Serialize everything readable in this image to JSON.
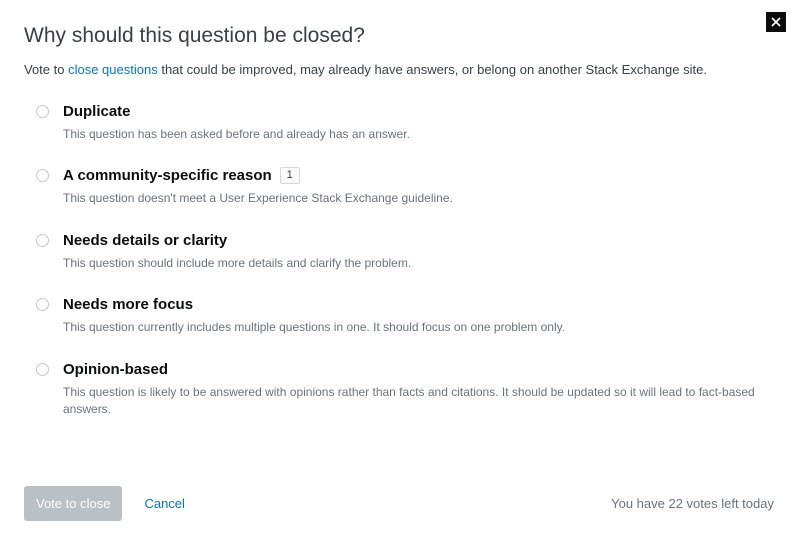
{
  "dialog": {
    "title": "Why should this question be closed?",
    "subtitle_pre": "Vote to ",
    "subtitle_link": "close questions",
    "subtitle_post": " that could be improved, may already have answers, or belong on another Stack Exchange site."
  },
  "options": [
    {
      "title": "Duplicate",
      "desc": "This question has been asked before and already has an answer."
    },
    {
      "title": "A community-specific reason",
      "badge": "1",
      "desc": "This question doesn't meet a User Experience Stack Exchange guideline."
    },
    {
      "title": "Needs details or clarity",
      "desc": "This question should include more details and clarify the problem."
    },
    {
      "title": "Needs more focus",
      "desc": "This question currently includes multiple questions in one. It should focus on one problem only."
    },
    {
      "title": "Opinion-based",
      "desc": "This question is likely to be answered with opinions rather than facts and citations. It should be updated so it will lead to fact-based answers."
    }
  ],
  "footer": {
    "vote_label": "Vote to close",
    "cancel_label": "Cancel",
    "votes_left": "You have 22 votes left today"
  }
}
